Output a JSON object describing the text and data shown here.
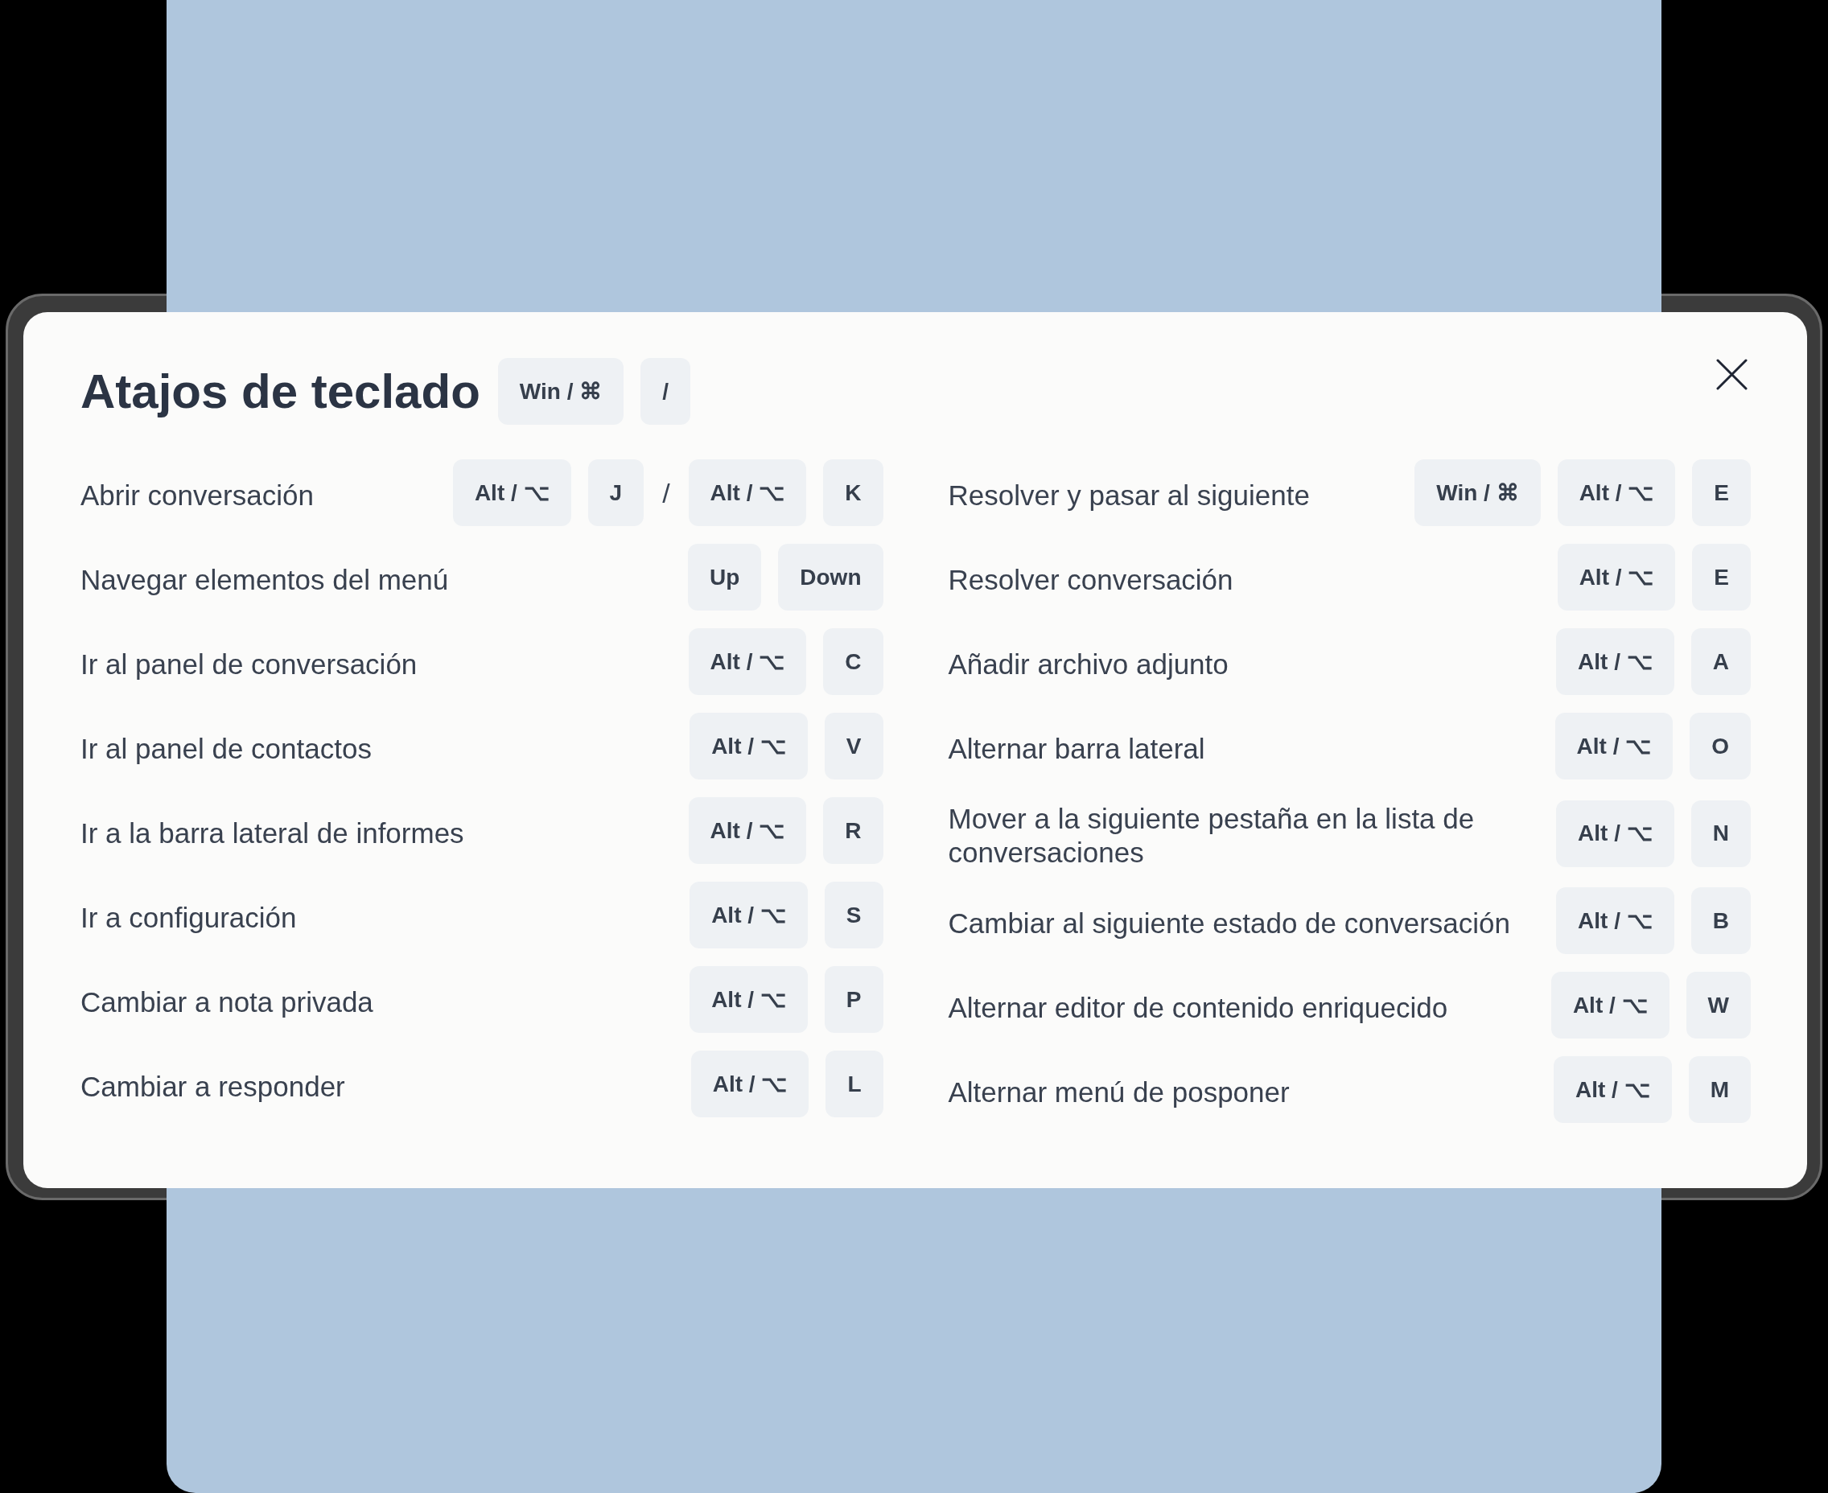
{
  "dialog": {
    "title": "Atajos de teclado",
    "title_keys": [
      {
        "kind": "key",
        "text": "Win / ⌘"
      },
      {
        "kind": "key",
        "text": "/"
      }
    ],
    "columns": [
      {
        "shortcuts": [
          {
            "label": "Abrir conversación",
            "keys": [
              {
                "kind": "key",
                "text": "Alt / ⌥"
              },
              {
                "kind": "key",
                "text": "J"
              },
              {
                "kind": "separator",
                "text": "/"
              },
              {
                "kind": "key",
                "text": "Alt / ⌥"
              },
              {
                "kind": "key",
                "text": "K"
              }
            ]
          },
          {
            "label": "Navegar elementos del menú",
            "keys": [
              {
                "kind": "key",
                "text": "Up"
              },
              {
                "kind": "key",
                "text": "Down"
              }
            ]
          },
          {
            "label": "Ir al panel de conversación",
            "keys": [
              {
                "kind": "key",
                "text": "Alt / ⌥"
              },
              {
                "kind": "key",
                "text": "C"
              }
            ]
          },
          {
            "label": "Ir al panel de contactos",
            "keys": [
              {
                "kind": "key",
                "text": "Alt / ⌥"
              },
              {
                "kind": "key",
                "text": "V"
              }
            ]
          },
          {
            "label": "Ir a la barra lateral de informes",
            "keys": [
              {
                "kind": "key",
                "text": "Alt / ⌥"
              },
              {
                "kind": "key",
                "text": "R"
              }
            ]
          },
          {
            "label": "Ir a configuración",
            "keys": [
              {
                "kind": "key",
                "text": "Alt / ⌥"
              },
              {
                "kind": "key",
                "text": "S"
              }
            ]
          },
          {
            "label": "Cambiar a nota privada",
            "keys": [
              {
                "kind": "key",
                "text": "Alt / ⌥"
              },
              {
                "kind": "key",
                "text": "P"
              }
            ]
          },
          {
            "label": "Cambiar a responder",
            "keys": [
              {
                "kind": "key",
                "text": "Alt / ⌥"
              },
              {
                "kind": "key",
                "text": "L"
              }
            ]
          }
        ]
      },
      {
        "shortcuts": [
          {
            "label": "Resolver y pasar al siguiente",
            "keys": [
              {
                "kind": "key",
                "text": "Win / ⌘"
              },
              {
                "kind": "key",
                "text": "Alt / ⌥"
              },
              {
                "kind": "key",
                "text": "E"
              }
            ]
          },
          {
            "label": "Resolver conversación",
            "keys": [
              {
                "kind": "key",
                "text": "Alt / ⌥"
              },
              {
                "kind": "key",
                "text": "E"
              }
            ]
          },
          {
            "label": "Añadir archivo adjunto",
            "keys": [
              {
                "kind": "key",
                "text": "Alt / ⌥"
              },
              {
                "kind": "key",
                "text": "A"
              }
            ]
          },
          {
            "label": "Alternar barra lateral",
            "keys": [
              {
                "kind": "key",
                "text": "Alt / ⌥"
              },
              {
                "kind": "key",
                "text": "O"
              }
            ]
          },
          {
            "label": "Mover a la siguiente pestaña en la lista de conversaciones",
            "keys": [
              {
                "kind": "key",
                "text": "Alt / ⌥"
              },
              {
                "kind": "key",
                "text": "N"
              }
            ]
          },
          {
            "label": "Cambiar al siguiente estado de conversación",
            "keys": [
              {
                "kind": "key",
                "text": "Alt / ⌥"
              },
              {
                "kind": "key",
                "text": "B"
              }
            ]
          },
          {
            "label": "Alternar editor de contenido enriquecido",
            "keys": [
              {
                "kind": "key",
                "text": "Alt / ⌥"
              },
              {
                "kind": "key",
                "text": "W"
              }
            ]
          },
          {
            "label": "Alternar menú de posponer",
            "keys": [
              {
                "kind": "key",
                "text": "Alt / ⌥"
              },
              {
                "kind": "key",
                "text": "M"
              }
            ]
          }
        ]
      }
    ]
  }
}
